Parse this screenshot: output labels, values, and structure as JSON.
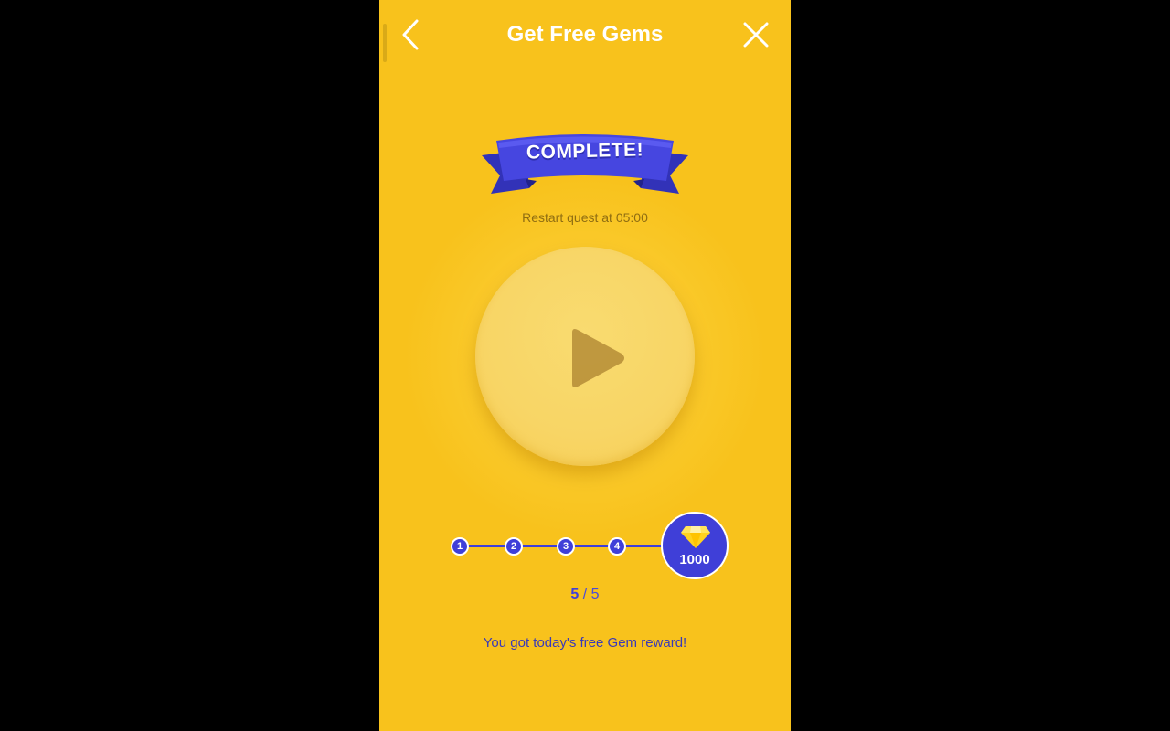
{
  "header": {
    "title": "Get Free Gems",
    "back_icon": "chevron-left-icon",
    "close_icon": "close-icon"
  },
  "banner": {
    "text": "COMPLETE!",
    "color": "#3f3fd8"
  },
  "restart_text": "Restart quest at 05:00",
  "play_button": {
    "icon": "play-icon"
  },
  "progress": {
    "steps": [
      "1",
      "2",
      "3",
      "4"
    ],
    "reward_icon": "gem-icon",
    "reward_amount": "1000",
    "current": "5",
    "separator": "/",
    "total": "5"
  },
  "message": "You got today's free Gem reward!",
  "colors": {
    "background": "#f8c21c",
    "accent": "#3f3fd8",
    "text_white": "#ffffff"
  }
}
